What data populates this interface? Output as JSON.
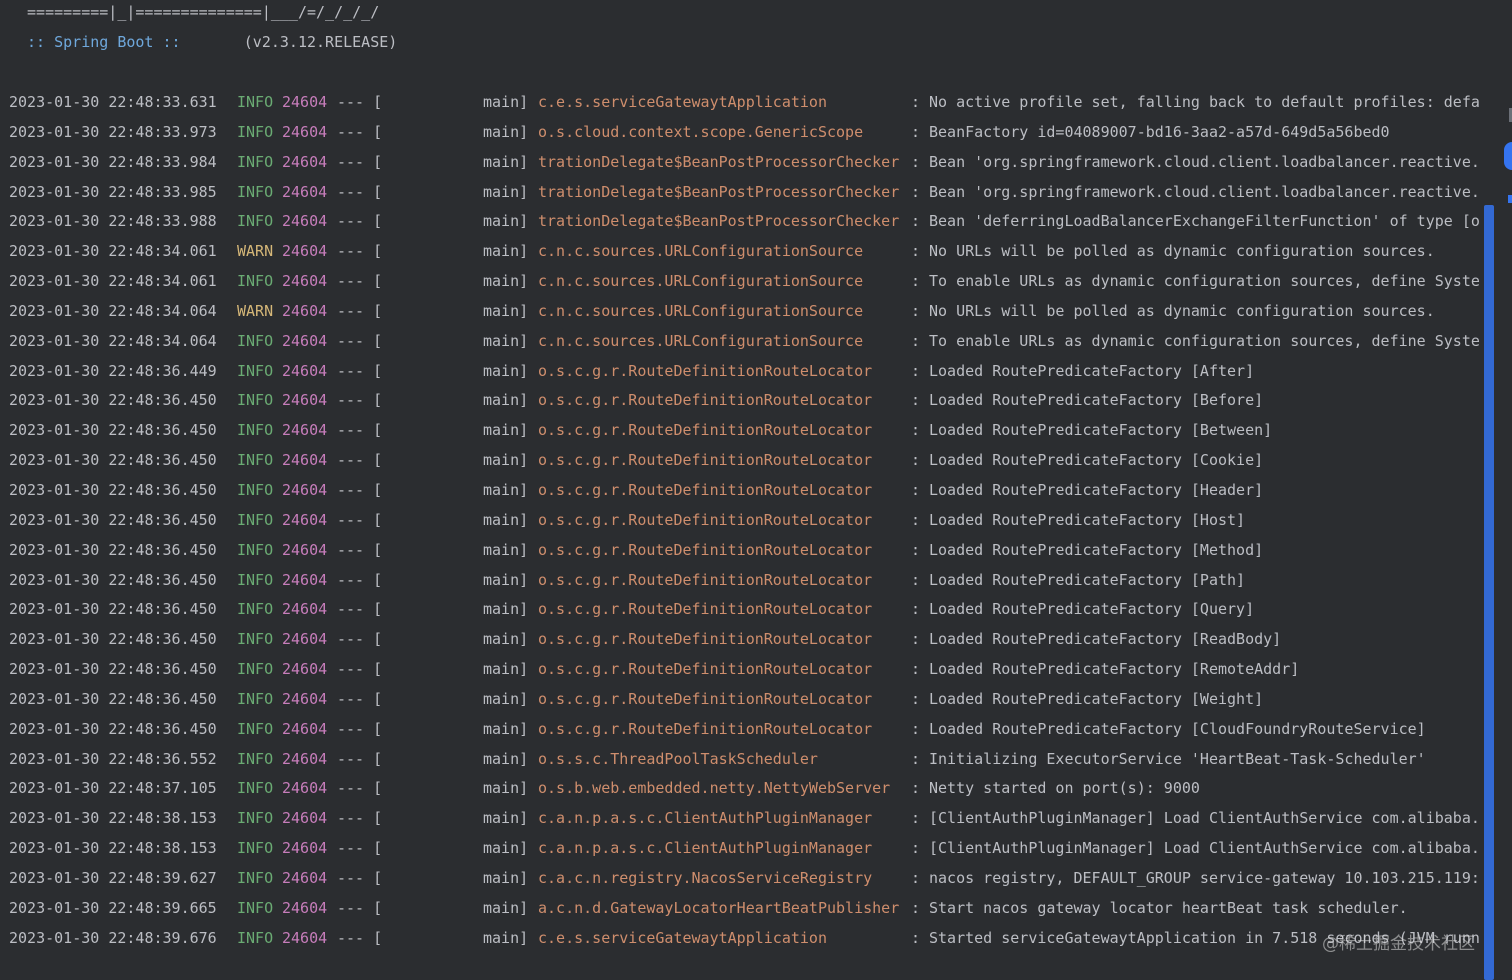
{
  "banner": {
    "ascii_line": " =========|_|==============|___/=/_/_/_/",
    "label": " :: Spring Boot :: ",
    "version": "(v2.3.12.RELEASE)"
  },
  "colors": {
    "background": "#2b2d30",
    "text": "#bcbec4",
    "info": "#6aab73",
    "warn": "#d5b778",
    "pid": "#c77dbb",
    "logger": "#cf8e6d",
    "scrollbar": "#3574f0"
  },
  "watermark": "@稀土掘金技术社区",
  "logs": [
    {
      "ts": "2023-01-30 22:48:33.631",
      "level": "INFO",
      "pid": "24604",
      "sep": "--- [",
      "thread": "main]",
      "logger": "c.e.s.serviceGatewaytApplication",
      "colon": ":",
      "msg": "No active profile set, falling back to default profiles: defa"
    },
    {
      "ts": "2023-01-30 22:48:33.973",
      "level": "INFO",
      "pid": "24604",
      "sep": "--- [",
      "thread": "main]",
      "logger": "o.s.cloud.context.scope.GenericScope",
      "colon": ":",
      "msg": "BeanFactory id=04089007-bd16-3aa2-a57d-649d5a56bed0"
    },
    {
      "ts": "2023-01-30 22:48:33.984",
      "level": "INFO",
      "pid": "24604",
      "sep": "--- [",
      "thread": "main]",
      "logger": "trationDelegate$BeanPostProcessorChecker",
      "colon": ":",
      "msg": "Bean 'org.springframework.cloud.client.loadbalancer.reactive."
    },
    {
      "ts": "2023-01-30 22:48:33.985",
      "level": "INFO",
      "pid": "24604",
      "sep": "--- [",
      "thread": "main]",
      "logger": "trationDelegate$BeanPostProcessorChecker",
      "colon": ":",
      "msg": "Bean 'org.springframework.cloud.client.loadbalancer.reactive."
    },
    {
      "ts": "2023-01-30 22:48:33.988",
      "level": "INFO",
      "pid": "24604",
      "sep": "--- [",
      "thread": "main]",
      "logger": "trationDelegate$BeanPostProcessorChecker",
      "colon": ":",
      "msg": "Bean 'deferringLoadBalancerExchangeFilterFunction' of type [o"
    },
    {
      "ts": "2023-01-30 22:48:34.061",
      "level": "WARN",
      "pid": "24604",
      "sep": "--- [",
      "thread": "main]",
      "logger": "c.n.c.sources.URLConfigurationSource",
      "colon": ":",
      "msg": "No URLs will be polled as dynamic configuration sources."
    },
    {
      "ts": "2023-01-30 22:48:34.061",
      "level": "INFO",
      "pid": "24604",
      "sep": "--- [",
      "thread": "main]",
      "logger": "c.n.c.sources.URLConfigurationSource",
      "colon": ":",
      "msg": "To enable URLs as dynamic configuration sources, define Syste"
    },
    {
      "ts": "2023-01-30 22:48:34.064",
      "level": "WARN",
      "pid": "24604",
      "sep": "--- [",
      "thread": "main]",
      "logger": "c.n.c.sources.URLConfigurationSource",
      "colon": ":",
      "msg": "No URLs will be polled as dynamic configuration sources."
    },
    {
      "ts": "2023-01-30 22:48:34.064",
      "level": "INFO",
      "pid": "24604",
      "sep": "--- [",
      "thread": "main]",
      "logger": "c.n.c.sources.URLConfigurationSource",
      "colon": ":",
      "msg": "To enable URLs as dynamic configuration sources, define Syste"
    },
    {
      "ts": "2023-01-30 22:48:36.449",
      "level": "INFO",
      "pid": "24604",
      "sep": "--- [",
      "thread": "main]",
      "logger": "o.s.c.g.r.RouteDefinitionRouteLocator",
      "colon": ":",
      "msg": "Loaded RoutePredicateFactory [After]"
    },
    {
      "ts": "2023-01-30 22:48:36.450",
      "level": "INFO",
      "pid": "24604",
      "sep": "--- [",
      "thread": "main]",
      "logger": "o.s.c.g.r.RouteDefinitionRouteLocator",
      "colon": ":",
      "msg": "Loaded RoutePredicateFactory [Before]"
    },
    {
      "ts": "2023-01-30 22:48:36.450",
      "level": "INFO",
      "pid": "24604",
      "sep": "--- [",
      "thread": "main]",
      "logger": "o.s.c.g.r.RouteDefinitionRouteLocator",
      "colon": ":",
      "msg": "Loaded RoutePredicateFactory [Between]"
    },
    {
      "ts": "2023-01-30 22:48:36.450",
      "level": "INFO",
      "pid": "24604",
      "sep": "--- [",
      "thread": "main]",
      "logger": "o.s.c.g.r.RouteDefinitionRouteLocator",
      "colon": ":",
      "msg": "Loaded RoutePredicateFactory [Cookie]"
    },
    {
      "ts": "2023-01-30 22:48:36.450",
      "level": "INFO",
      "pid": "24604",
      "sep": "--- [",
      "thread": "main]",
      "logger": "o.s.c.g.r.RouteDefinitionRouteLocator",
      "colon": ":",
      "msg": "Loaded RoutePredicateFactory [Header]"
    },
    {
      "ts": "2023-01-30 22:48:36.450",
      "level": "INFO",
      "pid": "24604",
      "sep": "--- [",
      "thread": "main]",
      "logger": "o.s.c.g.r.RouteDefinitionRouteLocator",
      "colon": ":",
      "msg": "Loaded RoutePredicateFactory [Host]"
    },
    {
      "ts": "2023-01-30 22:48:36.450",
      "level": "INFO",
      "pid": "24604",
      "sep": "--- [",
      "thread": "main]",
      "logger": "o.s.c.g.r.RouteDefinitionRouteLocator",
      "colon": ":",
      "msg": "Loaded RoutePredicateFactory [Method]"
    },
    {
      "ts": "2023-01-30 22:48:36.450",
      "level": "INFO",
      "pid": "24604",
      "sep": "--- [",
      "thread": "main]",
      "logger": "o.s.c.g.r.RouteDefinitionRouteLocator",
      "colon": ":",
      "msg": "Loaded RoutePredicateFactory [Path]"
    },
    {
      "ts": "2023-01-30 22:48:36.450",
      "level": "INFO",
      "pid": "24604",
      "sep": "--- [",
      "thread": "main]",
      "logger": "o.s.c.g.r.RouteDefinitionRouteLocator",
      "colon": ":",
      "msg": "Loaded RoutePredicateFactory [Query]"
    },
    {
      "ts": "2023-01-30 22:48:36.450",
      "level": "INFO",
      "pid": "24604",
      "sep": "--- [",
      "thread": "main]",
      "logger": "o.s.c.g.r.RouteDefinitionRouteLocator",
      "colon": ":",
      "msg": "Loaded RoutePredicateFactory [ReadBody]"
    },
    {
      "ts": "2023-01-30 22:48:36.450",
      "level": "INFO",
      "pid": "24604",
      "sep": "--- [",
      "thread": "main]",
      "logger": "o.s.c.g.r.RouteDefinitionRouteLocator",
      "colon": ":",
      "msg": "Loaded RoutePredicateFactory [RemoteAddr]"
    },
    {
      "ts": "2023-01-30 22:48:36.450",
      "level": "INFO",
      "pid": "24604",
      "sep": "--- [",
      "thread": "main]",
      "logger": "o.s.c.g.r.RouteDefinitionRouteLocator",
      "colon": ":",
      "msg": "Loaded RoutePredicateFactory [Weight]"
    },
    {
      "ts": "2023-01-30 22:48:36.450",
      "level": "INFO",
      "pid": "24604",
      "sep": "--- [",
      "thread": "main]",
      "logger": "o.s.c.g.r.RouteDefinitionRouteLocator",
      "colon": ":",
      "msg": "Loaded RoutePredicateFactory [CloudFoundryRouteService]"
    },
    {
      "ts": "2023-01-30 22:48:36.552",
      "level": "INFO",
      "pid": "24604",
      "sep": "--- [",
      "thread": "main]",
      "logger": "o.s.s.c.ThreadPoolTaskScheduler",
      "colon": ":",
      "msg": "Initializing ExecutorService 'HeartBeat-Task-Scheduler'"
    },
    {
      "ts": "2023-01-30 22:48:37.105",
      "level": "INFO",
      "pid": "24604",
      "sep": "--- [",
      "thread": "main]",
      "logger": "o.s.b.web.embedded.netty.NettyWebServer",
      "colon": ":",
      "msg": "Netty started on port(s): 9000"
    },
    {
      "ts": "2023-01-30 22:48:38.153",
      "level": "INFO",
      "pid": "24604",
      "sep": "--- [",
      "thread": "main]",
      "logger": "c.a.n.p.a.s.c.ClientAuthPluginManager",
      "colon": ":",
      "msg": "[ClientAuthPluginManager] Load ClientAuthService com.alibaba."
    },
    {
      "ts": "2023-01-30 22:48:38.153",
      "level": "INFO",
      "pid": "24604",
      "sep": "--- [",
      "thread": "main]",
      "logger": "c.a.n.p.a.s.c.ClientAuthPluginManager",
      "colon": ":",
      "msg": "[ClientAuthPluginManager] Load ClientAuthService com.alibaba."
    },
    {
      "ts": "2023-01-30 22:48:39.627",
      "level": "INFO",
      "pid": "24604",
      "sep": "--- [",
      "thread": "main]",
      "logger": "c.a.c.n.registry.NacosServiceRegistry",
      "colon": ":",
      "msg": "nacos registry, DEFAULT_GROUP service-gateway 10.103.215.119:"
    },
    {
      "ts": "2023-01-30 22:48:39.665",
      "level": "INFO",
      "pid": "24604",
      "sep": "--- [",
      "thread": "main]",
      "logger": "a.c.n.d.GatewayLocatorHeartBeatPublisher",
      "colon": ":",
      "msg": "Start nacos gateway locator heartBeat task scheduler."
    },
    {
      "ts": "2023-01-30 22:48:39.676",
      "level": "INFO",
      "pid": "24604",
      "sep": "--- [",
      "thread": "main]",
      "logger": "c.e.s.serviceGatewaytApplication",
      "colon": ":",
      "msg": "Started serviceGatewaytApplication in 7.518 seconds (JVM runn"
    }
  ]
}
